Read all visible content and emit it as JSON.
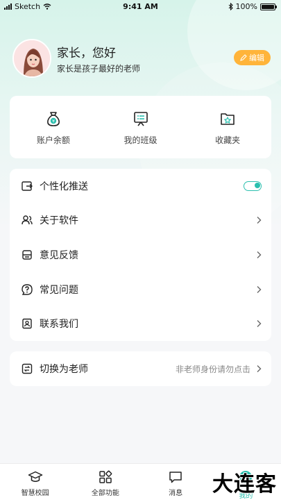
{
  "status_bar": {
    "carrier": "Sketch",
    "time": "9:41 AM",
    "battery": "100%"
  },
  "profile": {
    "greeting": "家长，您好",
    "motto": "家长是孩子最好的老师",
    "edit_label": "编辑"
  },
  "quick_actions": [
    {
      "label": "账户余额",
      "icon": "money-bag-icon"
    },
    {
      "label": "我的班级",
      "icon": "class-board-icon"
    },
    {
      "label": "收藏夹",
      "icon": "favorites-folder-icon"
    }
  ],
  "menu": [
    {
      "label": "个性化推送",
      "icon": "push-icon",
      "control": "toggle",
      "on": true
    },
    {
      "label": "关于软件",
      "icon": "about-users-icon",
      "control": "chevron"
    },
    {
      "label": "意见反馈",
      "icon": "feedback-icon",
      "control": "chevron"
    },
    {
      "label": "常见问题",
      "icon": "question-icon",
      "control": "chevron"
    },
    {
      "label": "联系我们",
      "icon": "contact-icon",
      "control": "chevron"
    }
  ],
  "switch_role": {
    "label": "切换为老师",
    "hint": "非老师身份请勿点击"
  },
  "tabbar": [
    {
      "label": "智慧校园",
      "icon": "graduation-cap-icon"
    },
    {
      "label": "全部功能",
      "icon": "grid-apps-icon"
    },
    {
      "label": "消息",
      "icon": "message-icon"
    },
    {
      "label": "我的",
      "icon": "profile-icon",
      "active": true
    }
  ],
  "watermark": "大连客",
  "colors": {
    "accent": "#2bbfae",
    "edit": "#ffb43a",
    "background": "#f6f7f9"
  }
}
